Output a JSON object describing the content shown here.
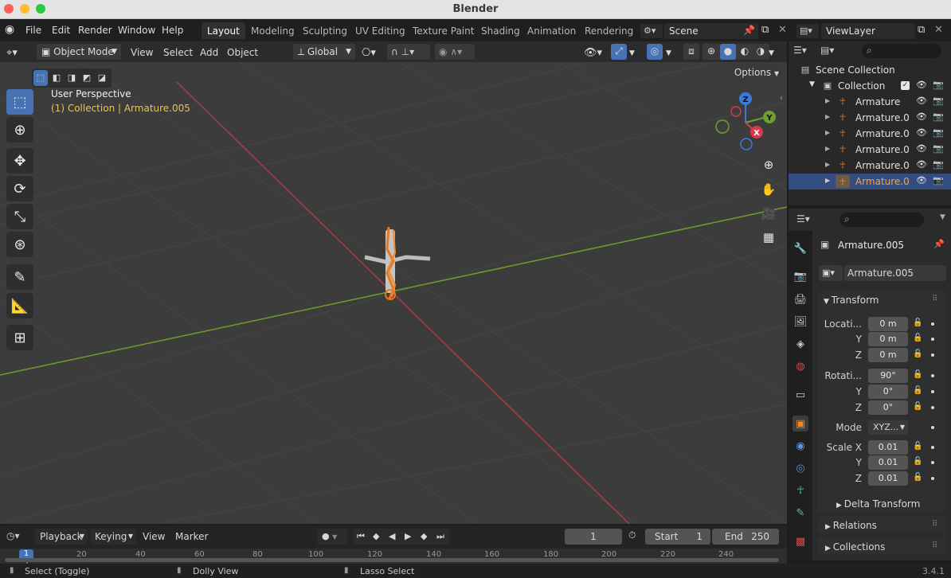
{
  "window": {
    "title": "Blender"
  },
  "menubar": {
    "items": [
      "File",
      "Edit",
      "Render",
      "Window",
      "Help"
    ],
    "workspaces": [
      "Layout",
      "Modeling",
      "Sculpting",
      "UV Editing",
      "Texture Paint",
      "Shading",
      "Animation",
      "Rendering"
    ],
    "scene": "Scene",
    "view_layer": "ViewLayer"
  },
  "viewport_header": {
    "mode": "Object Mode",
    "menus": [
      "View",
      "Select",
      "Add",
      "Object"
    ],
    "orientation": "Global",
    "options_label": "Options"
  },
  "viewport": {
    "perspective": "User Perspective",
    "collection_info": "(1) Collection | Armature.005",
    "gizmo": {
      "x": "X",
      "y": "Y",
      "z": "Z"
    },
    "colors": {
      "x_axis": "#d33a4a",
      "y_axis": "#6f9e2e",
      "z_axis": "#3a7ad9",
      "active_tool": "#4772b3",
      "selection": "#e8781c"
    }
  },
  "outliner": {
    "root": "Scene Collection",
    "collection": "Collection",
    "items": [
      {
        "label": "Armature",
        "active": false
      },
      {
        "label": "Armature.0",
        "active": false
      },
      {
        "label": "Armature.0",
        "active": false
      },
      {
        "label": "Armature.0",
        "active": false
      },
      {
        "label": "Armature.0",
        "active": false
      },
      {
        "label": "Armature.0",
        "active": true
      }
    ]
  },
  "properties": {
    "object_name": "Armature.005",
    "object_field": "Armature.005",
    "transform_label": "Transform",
    "location": {
      "label": "Locati...",
      "x": "0 m",
      "y": "0 m",
      "z": "0 m"
    },
    "rotation": {
      "label": "Rotati...",
      "x": "90°",
      "y": "0°",
      "z": "0°"
    },
    "mode": {
      "label": "Mode",
      "value": "XYZ..."
    },
    "scale": {
      "label": "Scale X",
      "x": "0.01",
      "y": "0.01",
      "z": "0.01"
    },
    "axis_y": "Y",
    "axis_z": "Z",
    "delta_transform": "Delta Transform",
    "relations": "Relations",
    "collections": "Collections"
  },
  "timeline": {
    "menus": [
      "Playback",
      "Keying",
      "View",
      "Marker"
    ],
    "current_frame": "1",
    "start_label": "Start",
    "start": "1",
    "end_label": "End",
    "end": "250",
    "ruler": [
      "1",
      "20",
      "40",
      "60",
      "80",
      "100",
      "120",
      "140",
      "160",
      "180",
      "200",
      "220",
      "240"
    ]
  },
  "statusbar": {
    "left": "Select (Toggle)",
    "middle": "Dolly View",
    "right": "Lasso Select",
    "version": "3.4.1"
  }
}
